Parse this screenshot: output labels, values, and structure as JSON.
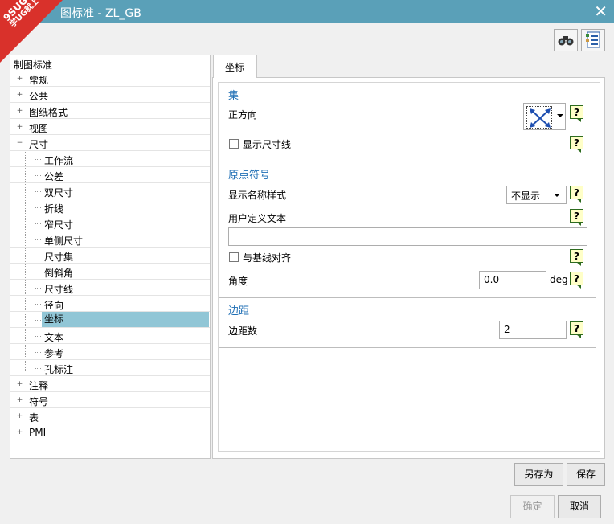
{
  "window": {
    "title": "图标准 - ZL_GB",
    "badge": {
      "line1": "9SUG",
      "line2": "学UG就上UG网"
    }
  },
  "toolbar": {
    "icons": [
      "binoculars-icon",
      "settings-list-icon"
    ]
  },
  "tree": {
    "root": "制图标准",
    "items": [
      {
        "label": "常规",
        "expander": "+"
      },
      {
        "label": "公共",
        "expander": "+"
      },
      {
        "label": "图纸格式",
        "expander": "+"
      },
      {
        "label": "视图",
        "expander": "+"
      },
      {
        "label": "尺寸",
        "expander": "−"
      },
      {
        "label": "工作流"
      },
      {
        "label": "公差"
      },
      {
        "label": "双尺寸"
      },
      {
        "label": "折线"
      },
      {
        "label": "窄尺寸"
      },
      {
        "label": "单侧尺寸"
      },
      {
        "label": "尺寸集"
      },
      {
        "label": "倒斜角"
      },
      {
        "label": "尺寸线"
      },
      {
        "label": "径向"
      },
      {
        "label": "坐标",
        "selected": true
      },
      {
        "label": "文本"
      },
      {
        "label": "参考"
      },
      {
        "label": "孔标注"
      },
      {
        "label": "注释",
        "expander": "+"
      },
      {
        "label": "符号",
        "expander": "+"
      },
      {
        "label": "表",
        "expander": "+"
      },
      {
        "label": "PMI",
        "expander": "+"
      }
    ]
  },
  "tab": {
    "label": "坐标"
  },
  "sections": {
    "set": {
      "title": "集",
      "positive_direction_label": "正方向",
      "show_dim_line_label": "显示尺寸线"
    },
    "origin": {
      "title": "原点符号",
      "display_name_style_label": "显示名称样式",
      "display_name_style_value": "不显示",
      "user_text_label": "用户定义文本",
      "user_text_value": "",
      "align_baseline_label": "与基线对齐",
      "angle_label": "角度",
      "angle_value": "0.0",
      "angle_unit": "deg"
    },
    "margin": {
      "title": "边距",
      "margin_count_label": "边距数",
      "margin_count_value": "2"
    }
  },
  "help_text": "?",
  "buttons": {
    "save_as": "另存为",
    "save": "保存",
    "ok": "确定",
    "cancel": "取消"
  },
  "colors": {
    "titlebar": "#5aa0b8",
    "selection": "#91c6d6",
    "section_title": "#1f6fb5",
    "badge": "#d9312b"
  }
}
